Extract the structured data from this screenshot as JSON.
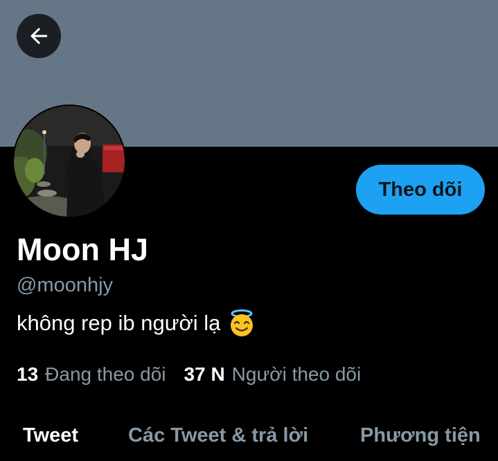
{
  "banner": {
    "color": "#657786"
  },
  "header": {
    "back_icon": "arrow-left-icon"
  },
  "profile": {
    "display_name": "Moon HJ",
    "handle": "@moonhjy",
    "bio": "không rep ib người lạ",
    "bio_emoji": "smiling-face-with-halo-icon",
    "follow_label": "Theo dõi"
  },
  "stats": {
    "following_count": "13",
    "following_label": "Đang theo dõi",
    "followers_count": "37 N",
    "followers_label": "Người theo dõi"
  },
  "tabs": [
    {
      "label": "Tweet",
      "active": true
    },
    {
      "label": "Các Tweet & trả lời",
      "active": false
    },
    {
      "label": "Phương tiện",
      "active": false
    }
  ],
  "colors": {
    "accent": "#1da1f2",
    "secondary_text": "#8899a6",
    "background": "#000000"
  }
}
